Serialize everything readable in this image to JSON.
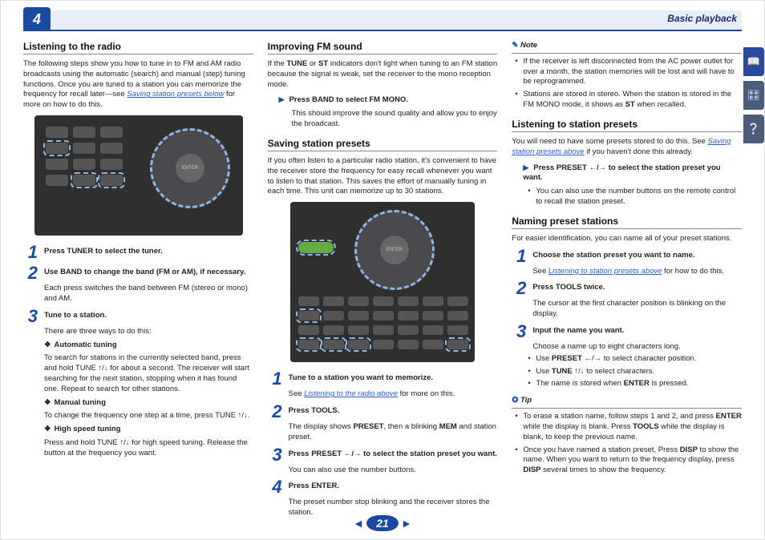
{
  "header": {
    "chapter": "4",
    "section": "Basic playback"
  },
  "page_number": "21",
  "col1": {
    "h1": "Listening to the radio",
    "intro1": "The following steps show you how to tune in to FM and AM radio broadcasts using the automatic (search) and manual (step) tuning functions. Once you are tuned to a station you can memorize the frequency for recall later—see ",
    "intro_link": "Saving station presets below",
    "intro2": " for more on how to do this.",
    "s1_bold": "Press TUNER to select the tuner.",
    "s2_bold": "Use BAND to change the band (FM or AM), if necessary.",
    "s2_body": "Each press switches the band between FM (stereo or mono) and AM.",
    "s3_bold": "Tune to a station.",
    "s3_body": "There are three ways to do this:",
    "auto_h": "Automatic tuning",
    "auto_b": "To search for stations in the currently selected band, press and hold TUNE ↑/↓ for about a second. The receiver will start searching for the next station, stopping when it has found one. Repeat to search for other stations.",
    "man_h": "Manual tuning",
    "man_b": "To change the frequency one step at a time, press TUNE ↑/↓.",
    "hs_h": "High speed tuning",
    "hs_b": "Press and hold TUNE ↑/↓ for high speed tuning. Release the button at the frequency you want."
  },
  "col2": {
    "h1": "Improving FM sound",
    "p1a": "If the ",
    "p1b": "TUNE",
    "p1c": " or ",
    "p1d": "ST",
    "p1e": " indicators don't light when tuning to an FM station because the signal is weak, set the receiver to the mono reception mode.",
    "arrow1": "Press BAND to select FM MONO.",
    "arrow1_sub": "This should improve the sound quality and allow you to enjoy the broadcast.",
    "h2": "Saving station presets",
    "p2": "If you often listen to a particular radio station, it's convenient to have the receiver store the frequency for easy recall whenever you want to listen to that station. This saves the effort of manually tuning in each time. This unit can memorize up to 30 stations.",
    "s1_bold": "Tune to a station you want to memorize.",
    "s1_body_a": "See ",
    "s1_link": "Listening to the radio above",
    "s1_body_b": " for more on this.",
    "s2_bold": "Press TOOLS.",
    "s2_body_a": "The display shows ",
    "s2_body_b": "PRESET",
    "s2_body_c": ", then a blinking ",
    "s2_body_d": "MEM",
    "s2_body_e": " and station preset.",
    "s3_bold": "Press PRESET ←/→ to select the station preset you want.",
    "s3_body": "You can also use the number buttons.",
    "s4_bold": "Press ENTER.",
    "s4_body": "The preset number stop blinking and the receiver stores the station."
  },
  "col3": {
    "note_h": "Note",
    "note_li1": "If the receiver is left disconnected from the AC power outlet for over a month, the station memories will be lost and will have to be reprogrammed.",
    "note_li2_a": "Stations are stored in stereo. When the station is stored in the FM MONO mode, it shows as ",
    "note_li2_b": "ST",
    "note_li2_c": " when recalled.",
    "h1": "Listening to station presets",
    "p1a": "You will need to have some presets stored to do this. See ",
    "p1_link": "Saving station presets above",
    "p1b": " if you haven't done this already.",
    "arrow1": "Press PRESET ←/→ to select the station preset you want.",
    "arrow1_li": "You can also use the number buttons on the remote control to recall the station preset.",
    "h2": "Naming preset stations",
    "p2": "For easier identification, you can name all of your preset stations.",
    "s1_bold": "Choose the station preset you want to name.",
    "s1_body_a": "See ",
    "s1_link": "Listening to station presets above",
    "s1_body_b": " for how to do this.",
    "s2_bold": "Press TOOLS twice.",
    "s2_body": "The cursor at the first character position is blinking on the display.",
    "s3_bold": "Input the name you want.",
    "s3_body": "Choose a name up to eight characters long.",
    "s3_li1_a": "Use ",
    "s3_li1_b": "PRESET",
    "s3_li1_c": " ←/→ to select character position.",
    "s3_li2_a": "Use ",
    "s3_li2_b": "TUNE",
    "s3_li2_c": " ↑/↓ to select characters.",
    "s3_li3_a": "The name is stored when ",
    "s3_li3_b": "ENTER",
    "s3_li3_c": " is pressed.",
    "tip_h": "Tip",
    "tip_li1_a": "To erase a station name, follow steps 1 and 2, and press ",
    "tip_li1_b": "ENTER",
    "tip_li1_c": " while the display is blank. Press ",
    "tip_li1_d": "TOOLS",
    "tip_li1_e": " while the display is blank, to keep the previous name.",
    "tip_li2_a": "Once you have named a station preset, Press ",
    "tip_li2_b": "DISP",
    "tip_li2_c": " to show the name. When you want to return to the frequency display, press ",
    "tip_li2_d": "DISP",
    "tip_li2_e": " several times to show the frequency."
  }
}
